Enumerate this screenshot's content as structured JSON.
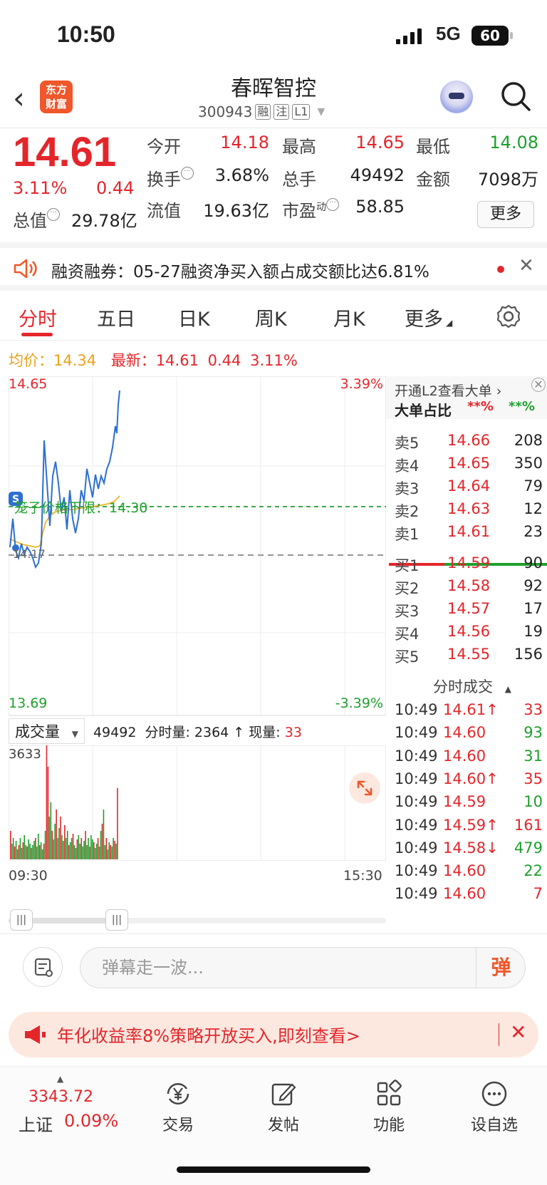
{
  "status": {
    "time": "10:50",
    "network": "5G",
    "battery": "60"
  },
  "header": {
    "logo_line1": "东方",
    "logo_line2": "财富",
    "name": "春晖智控",
    "code": "300943",
    "tags": [
      "融",
      "注",
      "L1"
    ]
  },
  "quote": {
    "price": "14.61",
    "pct": "3.11%",
    "change": "0.44",
    "open_label": "今开",
    "open": "14.18",
    "high_label": "最高",
    "high": "14.65",
    "low_label": "最低",
    "low": "14.08",
    "turnover_label": "换手",
    "turnover": "3.68%",
    "volume_label": "总手",
    "volume": "49492",
    "amount_label": "金额",
    "amount": "7098万",
    "total_value_label": "总值",
    "total_value": "29.78亿",
    "float_value_label": "流值",
    "float_value": "19.63亿",
    "pe_label": "市盈",
    "pe_sup": "动",
    "pe": "58.85",
    "more": "更多"
  },
  "notice": {
    "text": "融资融券：05-27融资净买入额占成交额比达6.81%"
  },
  "tabs": [
    "分时",
    "五日",
    "日K",
    "周K",
    "月K",
    "更多"
  ],
  "avg": {
    "avg_label": "均价：",
    "avg": "14.34",
    "latest_label": "最新：",
    "latest": "14.61",
    "chg": "0.44",
    "pct": "3.11%"
  },
  "chart": {
    "top_price": "14.65",
    "bottom_price": "13.69",
    "top_pct": "3.39%",
    "bottom_pct": "-3.39%",
    "cage_label": "笼子价格下限：14.30",
    "ref_label": "14.17",
    "vol_selector": "成交量",
    "vol_total": "49492",
    "vol_period_label": "分时量: 2364",
    "vol_now_label": "现量:",
    "vol_now": "33",
    "vol_max": "3633",
    "time_start": "09:30",
    "time_end": "15:30"
  },
  "chart_data": {
    "type": "line",
    "x": [
      "09:30",
      "15:30"
    ],
    "ylim": [
      13.69,
      14.65
    ],
    "series": []
  },
  "orderbook": {
    "l2_text": "开通L2查看大单",
    "big_label": "大单占比",
    "big_red": "**%",
    "big_green": "**%",
    "asks": [
      {
        "label": "卖5",
        "price": "14.66",
        "vol": "208"
      },
      {
        "label": "卖4",
        "price": "14.65",
        "vol": "350"
      },
      {
        "label": "卖3",
        "price": "14.64",
        "vol": "79"
      },
      {
        "label": "卖2",
        "price": "14.63",
        "vol": "12"
      },
      {
        "label": "卖1",
        "price": "14.61",
        "vol": "23"
      }
    ],
    "bids": [
      {
        "label": "买1",
        "price": "14.59",
        "vol": "90"
      },
      {
        "label": "买2",
        "price": "14.58",
        "vol": "92"
      },
      {
        "label": "买3",
        "price": "14.57",
        "vol": "17"
      },
      {
        "label": "买4",
        "price": "14.56",
        "vol": "19"
      },
      {
        "label": "买5",
        "price": "14.55",
        "vol": "156"
      }
    ],
    "trades_title": "分时成交",
    "trades": [
      {
        "time": "10:49",
        "price": "14.61↑",
        "vol": "33",
        "color": "#e4262b"
      },
      {
        "time": "10:49",
        "price": "14.60",
        "vol": "93",
        "color": "#1ea02d"
      },
      {
        "time": "10:49",
        "price": "14.60",
        "vol": "31",
        "color": "#1ea02d"
      },
      {
        "time": "10:49",
        "price": "14.60↑",
        "vol": "35",
        "color": "#e4262b"
      },
      {
        "time": "10:49",
        "price": "14.59",
        "vol": "10",
        "color": "#1ea02d"
      },
      {
        "time": "10:49",
        "price": "14.59↑",
        "vol": "161",
        "color": "#e4262b"
      },
      {
        "time": "10:49",
        "price": "14.58↓",
        "vol": "479",
        "color": "#1ea02d"
      },
      {
        "time": "10:49",
        "price": "14.60",
        "vol": "22",
        "color": "#1ea02d"
      },
      {
        "time": "10:49",
        "price": "14.60",
        "vol": "7",
        "color": "#e4262b"
      }
    ]
  },
  "input": {
    "placeholder": "弹幕走一波...",
    "send": "弹"
  },
  "banner": {
    "text": "年化收益率8%策略开放买入,即刻查看>"
  },
  "nav": {
    "index_value": "3343.72",
    "index_name": "上证",
    "index_pct": "0.09%",
    "items": [
      "交易",
      "发帖",
      "功能",
      "设自选"
    ]
  },
  "colors": {
    "up": "#e4262b",
    "down": "#1ea02d",
    "accent": "#f0572a"
  }
}
